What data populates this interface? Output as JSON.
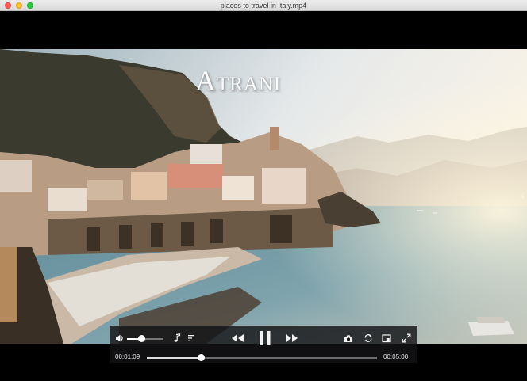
{
  "window": {
    "title": "places to travel in Italy.mp4"
  },
  "video": {
    "caption": "Atrani"
  },
  "controls": {
    "volume_level": 0.4,
    "progress": 0.233,
    "current_time": "00:01:09",
    "total_time": "00:05:00"
  },
  "colors": {
    "controls_bg": "#141416",
    "accent": "#ffffff"
  }
}
